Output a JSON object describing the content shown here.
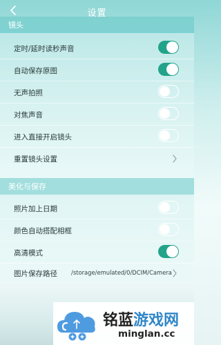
{
  "header": {
    "title": "设置"
  },
  "sections": [
    {
      "title": "镜头",
      "items": [
        {
          "label": "定时/延时读秒声音",
          "control": "toggle",
          "on": true
        },
        {
          "label": "自动保存原图",
          "control": "toggle",
          "on": true
        },
        {
          "label": "无声拍照",
          "control": "toggle",
          "on": false
        },
        {
          "label": "对焦声音",
          "control": "toggle",
          "on": false
        },
        {
          "label": "进入直接开启镜头",
          "control": "toggle",
          "on": false
        },
        {
          "label": "重置镜头设置",
          "control": "chevron"
        }
      ]
    },
    {
      "title": "美化与保存",
      "items": [
        {
          "label": "照片加上日期",
          "control": "toggle",
          "on": false
        },
        {
          "label": "颜色自动搭配相框",
          "control": "toggle",
          "on": false
        },
        {
          "label": "高清模式",
          "control": "toggle",
          "on": true
        },
        {
          "label": "图片保存路径",
          "control": "chevron",
          "value": "/storage/emulated/0/DCIM/Camera"
        }
      ]
    }
  ],
  "watermark": {
    "cn_part1": "铭蓝",
    "cn_part2": "游戏网",
    "domain": "minglan.cc"
  },
  "colors": {
    "toggle_on": "#22a38a",
    "toggle_off_border": "#ffffff",
    "section_header_bg": "#7dd1d0",
    "label_text": "#2a3a3a",
    "watermark_blue": "#2f86c9"
  },
  "icons": {
    "back": "chevron-left-icon",
    "row_arrow": "chevron-right-icon",
    "logo": "cloud-logo-icon"
  }
}
